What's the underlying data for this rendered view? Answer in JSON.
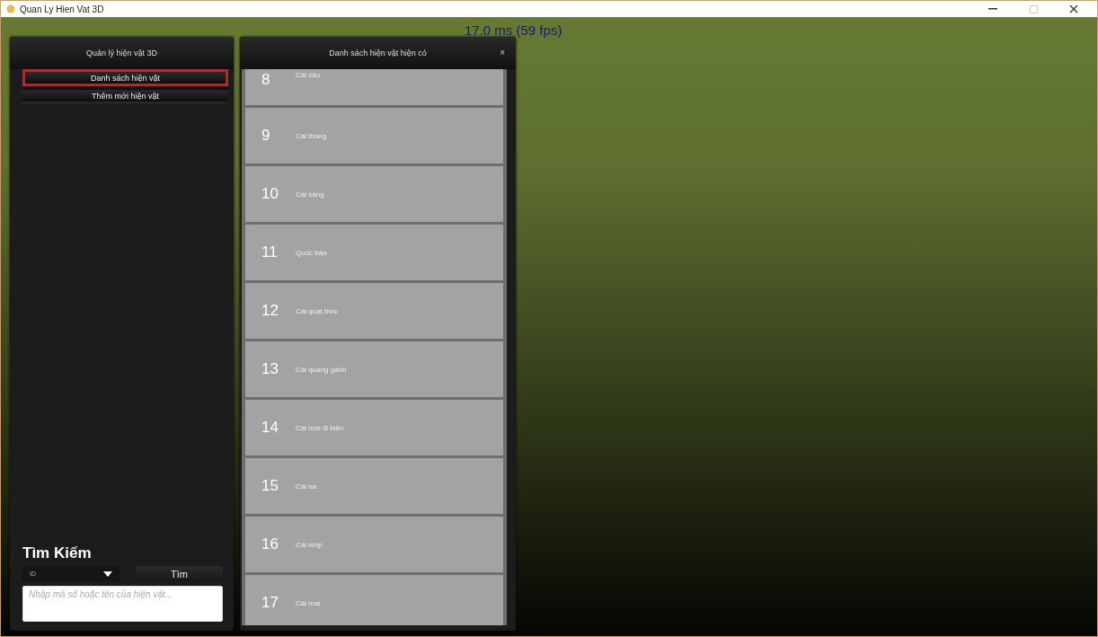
{
  "window": {
    "title": "Quan Ly Hien Vat 3D"
  },
  "fps": "17.0 ms (59 fps)",
  "left_panel": {
    "title": "Quản lý hiện vật 3D",
    "menu": [
      {
        "label": "Danh sách hiện vật",
        "selected": true
      },
      {
        "label": "Thêm mới hiện vật",
        "selected": false
      }
    ],
    "search": {
      "title": "Tìm Kiếm",
      "dropdown": "ID",
      "button": "Tìm",
      "placeholder": "Nhập mã số hoặc tên của hiện vật..."
    }
  },
  "list_panel": {
    "title": "Danh sách hiện vật hiện có",
    "close": "×",
    "items": [
      {
        "number": "8",
        "name": "Cái xảo"
      },
      {
        "number": "9",
        "name": "Cái thúng"
      },
      {
        "number": "10",
        "name": "Cái sàng"
      },
      {
        "number": "11",
        "name": "Quốc bàn"
      },
      {
        "number": "12",
        "name": "Cái quạt thóc"
      },
      {
        "number": "13",
        "name": "Cái quang gánh"
      },
      {
        "number": "14",
        "name": "Cái nón đi biển"
      },
      {
        "number": "15",
        "name": "Cái na"
      },
      {
        "number": "16",
        "name": "Cái nhíp"
      },
      {
        "number": "17",
        "name": "Cái mai"
      }
    ]
  }
}
